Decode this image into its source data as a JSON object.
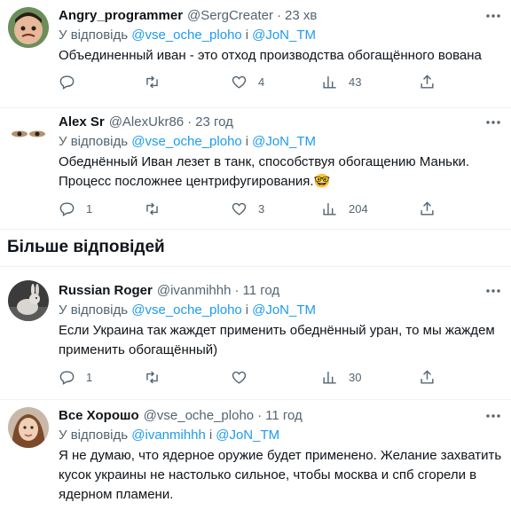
{
  "reply_prefix": "У відповідь",
  "and_word": "і",
  "tweets": [
    {
      "name": "Angry_programmer",
      "handle": "@SergCreater",
      "time": "23 хв",
      "replying_to": [
        "@vse_oche_ploho",
        "@JoN_TM"
      ],
      "text": "Объединенный иван - это отход производства обогащённого вована",
      "replies": "",
      "retweets": "",
      "likes": "4",
      "views": "43"
    },
    {
      "name": "Alex Sr",
      "handle": "@AlexUkr86",
      "time": "23 год",
      "replying_to": [
        "@vse_oche_ploho",
        "@JoN_TM"
      ],
      "text": "Обеднённый Иван лезет в танк, способствуя обогащению Маньки. Процесс посложнее центрифугирования.",
      "emoji": "🤓",
      "replies": "1",
      "retweets": "",
      "likes": "3",
      "views": "204"
    },
    {
      "name": "Russian Roger",
      "handle": "@ivanmihhh",
      "time": "11 год",
      "replying_to": [
        "@vse_oche_ploho",
        "@JoN_TM"
      ],
      "text": "Если Украина так жаждет применить обеднённый уран, то мы жаждем применить обогащённый)",
      "replies": "1",
      "retweets": "",
      "likes": "",
      "views": "30"
    },
    {
      "name": "Все Хорошо",
      "handle": "@vse_oche_ploho",
      "time": "11 год",
      "replying_to": [
        "@ivanmihhh",
        "@JoN_TM"
      ],
      "text": "Я не думаю, что ядерное оружие будет применено. Желание захватить кусок украины не настолько сильное, чтобы москва и спб сгорели в ядерном пламени."
    }
  ],
  "section_title": "Більше відповідей",
  "dot": "·",
  "icons": {
    "reply": "reply-icon",
    "retweet": "retweet-icon",
    "like": "heart-icon",
    "views": "views-icon",
    "share": "share-icon",
    "more": "more-icon"
  },
  "colors": {
    "accent": "#1d9bf0",
    "secondary_text": "#536471",
    "border": "#eff3f4"
  }
}
